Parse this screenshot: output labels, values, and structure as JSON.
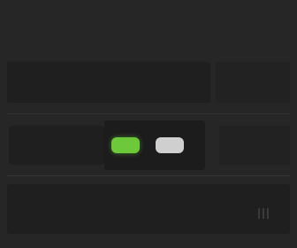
{
  "controls": {
    "toggle_on": {
      "state": "on",
      "color": "#6ec83c"
    },
    "toggle_off": {
      "state": "off",
      "color": "#cfcfcf"
    }
  }
}
